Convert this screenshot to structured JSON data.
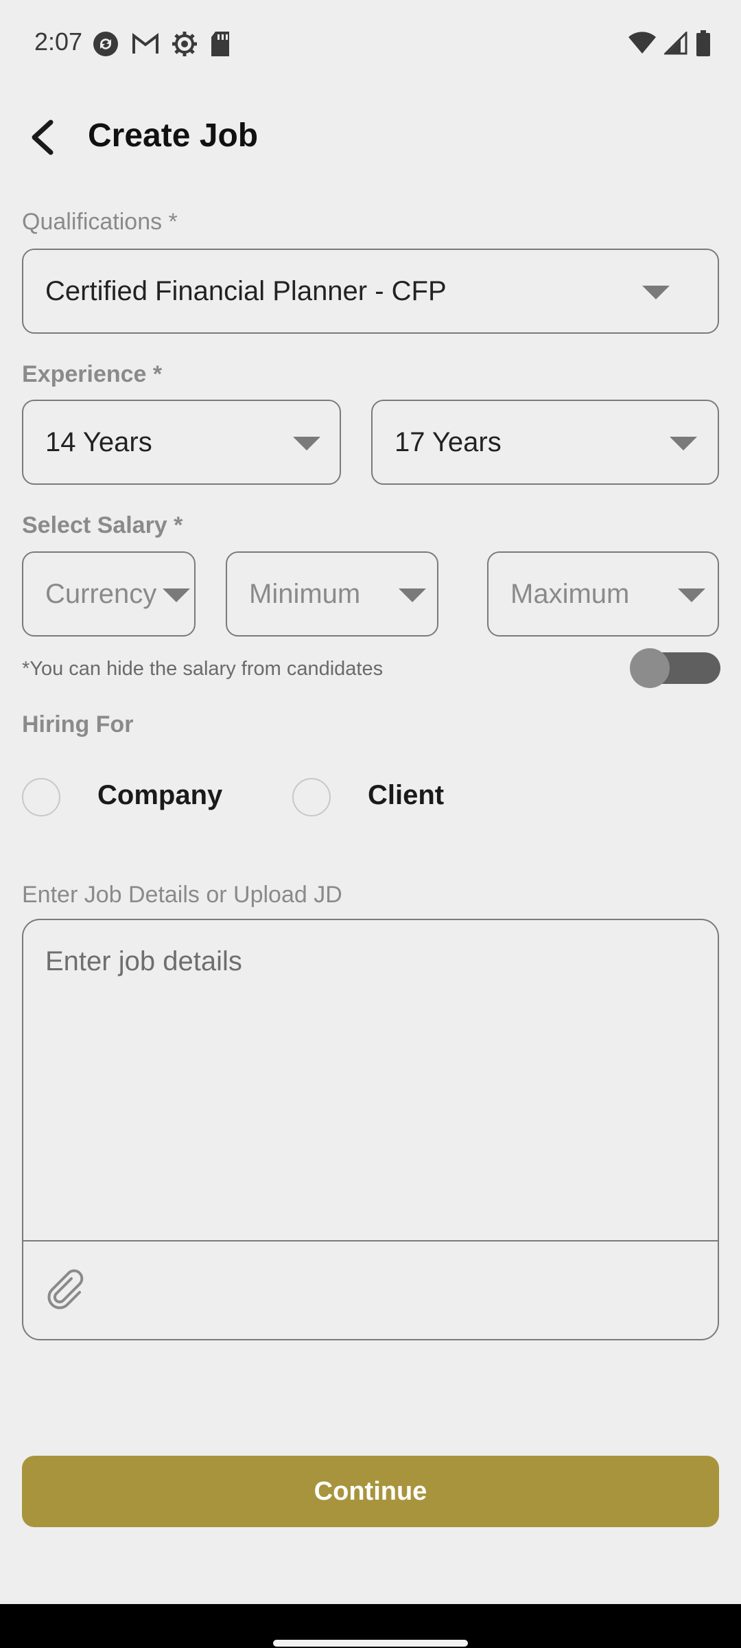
{
  "status_bar": {
    "time": "2:07",
    "left_icons": [
      "sync-icon",
      "gmail-icon",
      "settings-icon",
      "sd-card-icon"
    ],
    "right_icons": [
      "wifi-icon",
      "signal-icon",
      "battery-icon"
    ]
  },
  "header": {
    "back_icon": "chevron-left-icon",
    "title": "Create Job"
  },
  "qualifications": {
    "label": "Qualifications *",
    "value": "Certified Financial Planner - CFP"
  },
  "experience": {
    "label": "Experience *",
    "min_value": "14 Years",
    "max_value": "17 Years"
  },
  "salary": {
    "label": "Select Salary *",
    "currency_placeholder": "Currency",
    "minimum_placeholder": "Minimum",
    "maximum_placeholder": "Maximum",
    "hide_hint": "*You can hide the salary from candidates",
    "hide_toggle_on": false
  },
  "hiring_for": {
    "label": "Hiring For",
    "options": [
      "Company",
      "Client"
    ]
  },
  "job_details": {
    "label": "Enter Job Details or Upload JD",
    "placeholder": "Enter job details",
    "attach_icon": "paperclip-icon"
  },
  "continue_label": "Continue",
  "colors": {
    "background": "#eeeeee",
    "accent": "#a8943c",
    "border": "#7a7a7a"
  }
}
